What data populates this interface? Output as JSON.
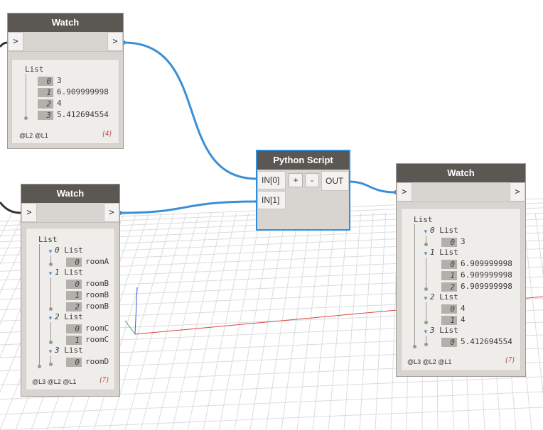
{
  "watch1": {
    "title": "Watch",
    "in_glyph": ">",
    "out_glyph": ">",
    "root_label": "List",
    "items": [
      {
        "index": "0",
        "value": "3"
      },
      {
        "index": "1",
        "value": "6.909999998"
      },
      {
        "index": "2",
        "value": "4"
      },
      {
        "index": "3",
        "value": "5.412694554"
      }
    ],
    "levels": "@L2 @L1",
    "count": "{4}"
  },
  "watch2": {
    "title": "Watch",
    "in_glyph": ">",
    "out_glyph": ">",
    "root_label": "List",
    "groups": [
      {
        "index": "0",
        "label": "List",
        "items": [
          {
            "index": "0",
            "value": "roomA"
          }
        ]
      },
      {
        "index": "1",
        "label": "List",
        "items": [
          {
            "index": "0",
            "value": "roomB"
          },
          {
            "index": "1",
            "value": "roomB"
          },
          {
            "index": "2",
            "value": "roomB"
          }
        ]
      },
      {
        "index": "2",
        "label": "List",
        "items": [
          {
            "index": "0",
            "value": "roomC"
          },
          {
            "index": "1",
            "value": "roomC"
          }
        ]
      },
      {
        "index": "3",
        "label": "List",
        "items": [
          {
            "index": "0",
            "value": "roomD"
          }
        ]
      }
    ],
    "levels": "@L3 @L2 @L1",
    "count": "{7}"
  },
  "python": {
    "title": "Python Script",
    "inputs": [
      "IN[0]",
      "IN[1]"
    ],
    "add_label": "+",
    "remove_label": "-",
    "output": "OUT"
  },
  "watch3": {
    "title": "Watch",
    "in_glyph": ">",
    "out_glyph": ">",
    "root_label": "List",
    "groups": [
      {
        "index": "0",
        "label": "List",
        "items": [
          {
            "index": "0",
            "value": "3"
          }
        ]
      },
      {
        "index": "1",
        "label": "List",
        "items": [
          {
            "index": "0",
            "value": "6.909999998"
          },
          {
            "index": "1",
            "value": "6.909999998"
          },
          {
            "index": "2",
            "value": "6.909999998"
          }
        ]
      },
      {
        "index": "2",
        "label": "List",
        "items": [
          {
            "index": "0",
            "value": "4"
          },
          {
            "index": "1",
            "value": "4"
          }
        ]
      },
      {
        "index": "3",
        "label": "List",
        "items": [
          {
            "index": "0",
            "value": "5.412694554"
          }
        ]
      }
    ],
    "levels": "@L3 @L2 @L1",
    "count": "{7}"
  },
  "colors": {
    "wire": "#3a8fd6",
    "header": "#5b5753",
    "selected_border": "#2f8fde",
    "grid": "#d9dcdf"
  }
}
